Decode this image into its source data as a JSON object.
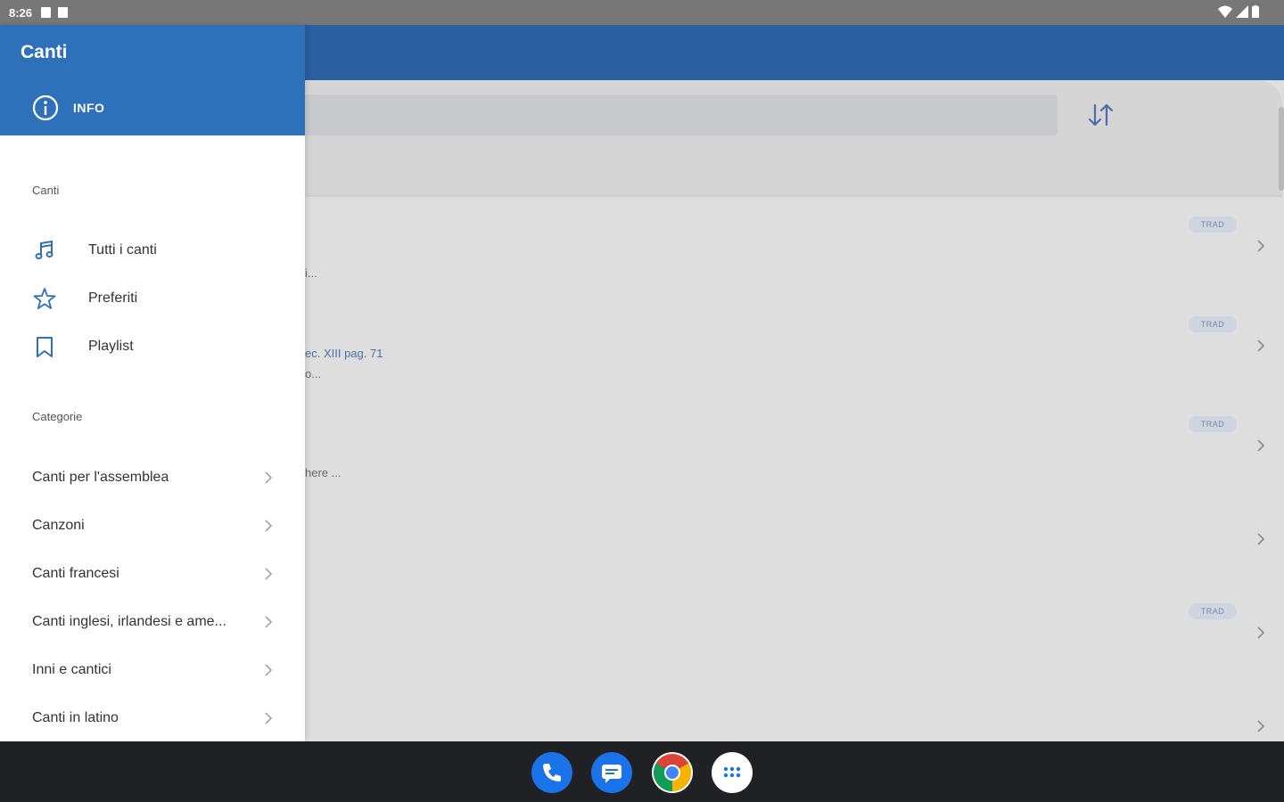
{
  "status_bar": {
    "time": "8:26"
  },
  "drawer": {
    "title": "Canti",
    "info_label": "INFO",
    "section_songs": "Canti",
    "nav_items": [
      {
        "label": "Tutti i canti",
        "icon": "music-note-icon"
      },
      {
        "label": "Preferiti",
        "icon": "star-icon"
      },
      {
        "label": "Playlist",
        "icon": "bookmark-icon"
      }
    ],
    "section_categories": "Categorie",
    "categories": [
      {
        "label": "Canti per l'assemblea"
      },
      {
        "label": "Canzoni"
      },
      {
        "label": "Canti francesi"
      },
      {
        "label": "Canti inglesi, irlandesi e ame..."
      },
      {
        "label": "Inni e cantici"
      },
      {
        "label": "Canti in latino"
      }
    ]
  },
  "list": {
    "rows": [
      {
        "snippet": "i...",
        "snippet2": "",
        "badge": "TRAD"
      },
      {
        "snippet": "ec. XIII pag. 71",
        "snippet2": "o...",
        "badge": "TRAD"
      },
      {
        "snippet": "here ...",
        "snippet2": "",
        "badge": "TRAD"
      },
      {
        "snippet": "",
        "snippet2": "",
        "badge": ""
      },
      {
        "snippet": "",
        "snippet2": "",
        "badge": "TRAD"
      },
      {
        "snippet": "",
        "snippet2": "",
        "badge": ""
      }
    ]
  },
  "dock": [
    {
      "name": "phone-app",
      "icon": "phone-icon",
      "color": "#1a73e8"
    },
    {
      "name": "messages-app",
      "icon": "messages-icon",
      "color": "#1a73e8"
    },
    {
      "name": "chrome-app",
      "icon": "chrome-icon",
      "color": "#ffffff"
    },
    {
      "name": "app-drawer",
      "icon": "apps-grid-icon",
      "color": "#ffffff"
    }
  ],
  "colors": {
    "primary": "#2e71ba",
    "app_bar": "#2b5f9f",
    "badge_text": "#6f8bb4"
  }
}
